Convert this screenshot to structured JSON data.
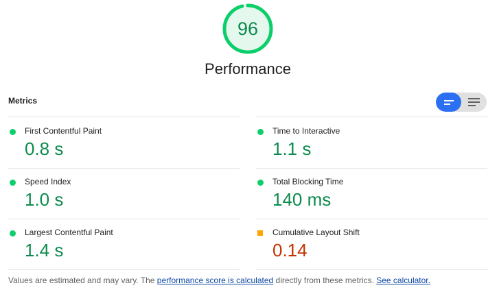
{
  "gauge": {
    "score": "96",
    "score_fraction": 0.96,
    "title": "Performance",
    "color": "#0cce6b",
    "text_color": "#0c8a4d",
    "bg_color": "#e5f8ee"
  },
  "metrics": {
    "header": "Metrics",
    "toggle": {
      "active_icon": "compact-view-icon",
      "inactive_icon": "expanded-view-icon"
    },
    "items": [
      {
        "label": "First Contentful Paint",
        "value": "0.8 s",
        "rating": "pass"
      },
      {
        "label": "Time to Interactive",
        "value": "1.1 s",
        "rating": "pass"
      },
      {
        "label": "Speed Index",
        "value": "1.0 s",
        "rating": "pass"
      },
      {
        "label": "Total Blocking Time",
        "value": "140 ms",
        "rating": "pass"
      },
      {
        "label": "Largest Contentful Paint",
        "value": "1.4 s",
        "rating": "pass"
      },
      {
        "label": "Cumulative Layout Shift",
        "value": "0.14",
        "rating": "average"
      }
    ]
  },
  "footer": {
    "prefix": "Values are estimated and may vary. The ",
    "link1": "performance score is calculated",
    "middle": " directly from these metrics. ",
    "link2": "See calculator."
  },
  "colors": {
    "pass": "#0cce6b",
    "pass_text": "#0c8a4d",
    "average": "#ffa400",
    "average_text": "#c33300",
    "toggle_active": "#2d6ff2",
    "link": "#0d47a1"
  }
}
